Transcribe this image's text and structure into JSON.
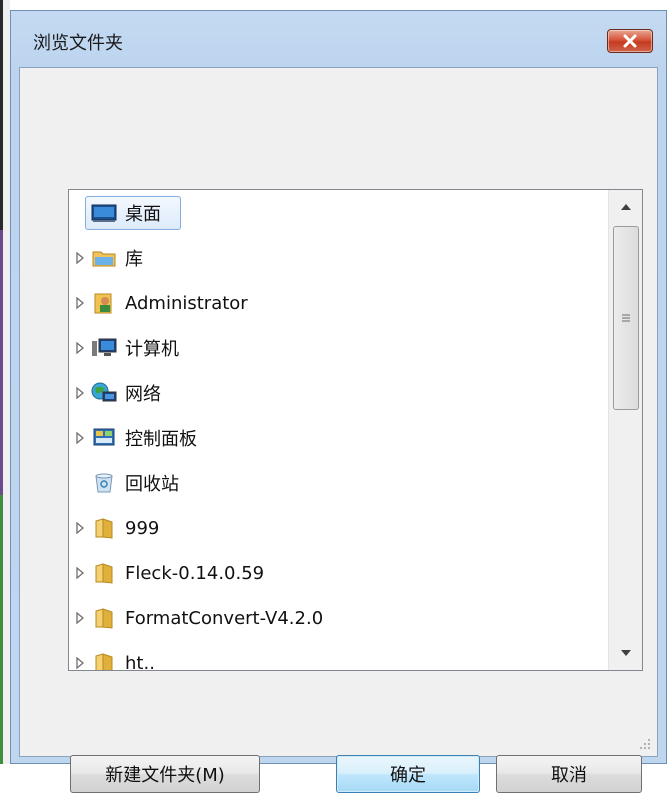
{
  "window": {
    "title": "浏览文件夹",
    "close_icon": "close-icon"
  },
  "tree": {
    "items": [
      {
        "label": "桌面",
        "icon": "desktop-icon",
        "expandable": false,
        "selected": true
      },
      {
        "label": "库",
        "icon": "library-icon",
        "expandable": true
      },
      {
        "label": "Administrator",
        "icon": "user-folder-icon",
        "expandable": true
      },
      {
        "label": "计算机",
        "icon": "computer-icon",
        "expandable": true
      },
      {
        "label": "网络",
        "icon": "network-icon",
        "expandable": true
      },
      {
        "label": "控制面板",
        "icon": "control-panel-icon",
        "expandable": true
      },
      {
        "label": "回收站",
        "icon": "recycle-bin-icon",
        "expandable": false
      },
      {
        "label": "999",
        "icon": "folder-icon",
        "expandable": true
      },
      {
        "label": "Fleck-0.14.0.59",
        "icon": "folder-icon",
        "expandable": true
      },
      {
        "label": "FormatConvert-V4.2.0",
        "icon": "folder-icon",
        "expandable": true
      },
      {
        "label": "ht..",
        "icon": "folder-icon",
        "expandable": true
      }
    ]
  },
  "buttons": {
    "new_folder": "新建文件夹(M)",
    "ok": "确定",
    "cancel": "取消"
  },
  "colors": {
    "title_bar": "#bfd6ef",
    "close_button": "#c43b1f",
    "selection_border": "#84acdd",
    "primary_button_border": "#3c7fb1"
  }
}
